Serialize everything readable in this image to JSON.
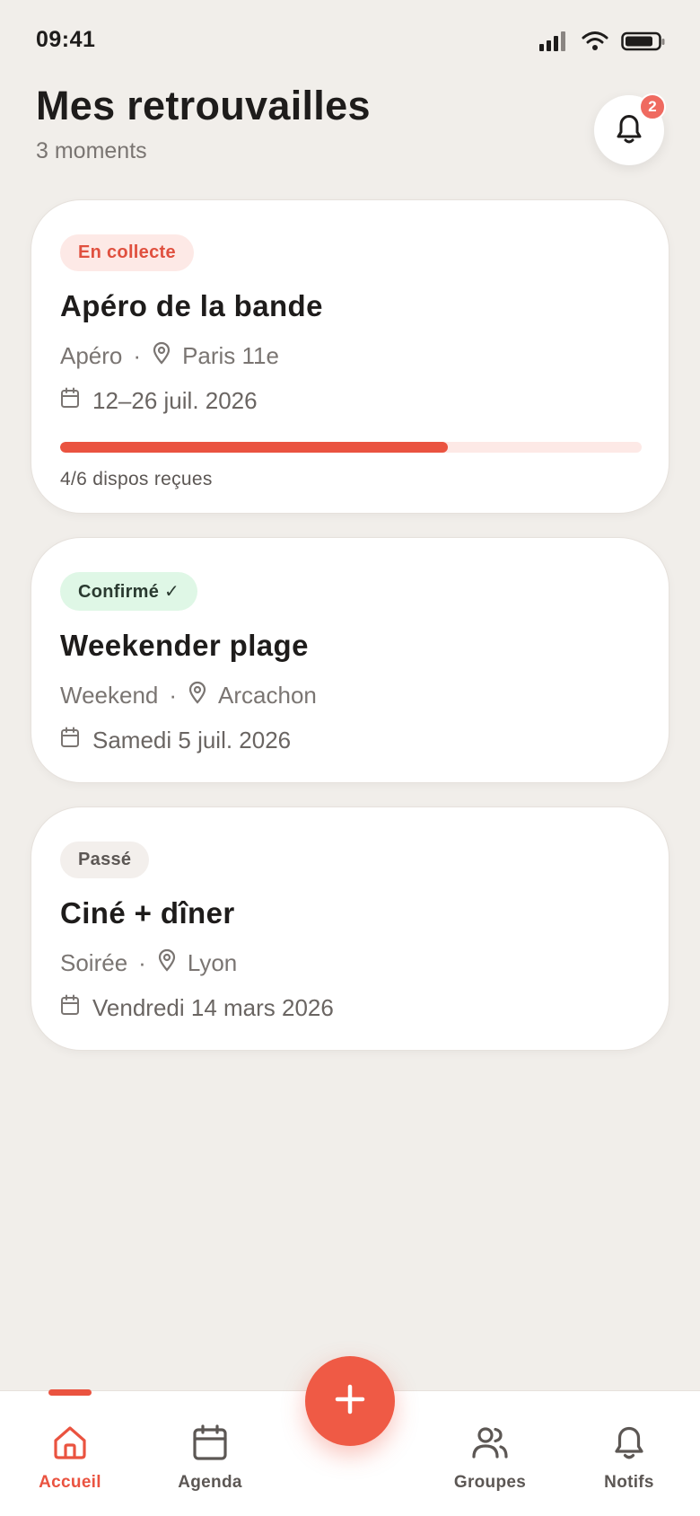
{
  "status_bar": {
    "time": "09:41"
  },
  "header": {
    "title": "Mes retrouvailles",
    "subtitle": "3 moments",
    "notification_count": "2"
  },
  "events": [
    {
      "status": "En collecte",
      "title": "Apéro de la bande",
      "type": "Apéro",
      "location": "Paris 11e",
      "date": "12–26 juil. 2026",
      "progress": {
        "received": 4,
        "total": 6,
        "label": "4/6 dispos reçues"
      }
    },
    {
      "status": "Confirmé ✓",
      "title": "Weekender plage",
      "type": "Weekend",
      "location": "Arcachon",
      "date": "Samedi 5 juil. 2026"
    },
    {
      "status": "Passé",
      "title": "Ciné + dîner",
      "type": "Soirée",
      "location": "Lyon",
      "date": "Vendredi 14 mars 2026"
    }
  ],
  "nav": {
    "items": [
      {
        "label": "Accueil",
        "icon": "home-icon",
        "active": true
      },
      {
        "label": "Agenda",
        "icon": "calendar-icon",
        "active": false
      },
      {
        "label": "Groupes",
        "icon": "users-icon",
        "active": false
      },
      {
        "label": "Notifs",
        "icon": "bell-icon",
        "active": false
      }
    ],
    "fab_icon": "plus-icon"
  },
  "colors": {
    "accent": "#ea5340",
    "background": "#f1eeea",
    "confirmed_badge": "#dff7e6",
    "collect_badge": "#fde9e6"
  }
}
